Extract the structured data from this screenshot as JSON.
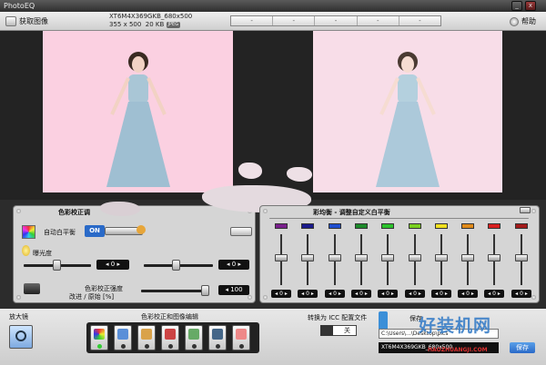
{
  "window": {
    "title": "PhotoEQ",
    "minimize": "_",
    "close": "x"
  },
  "toolbar": {
    "open_label": "获取图像",
    "help_label": "帮助"
  },
  "file": {
    "name": "XT6M4X369GKB_680x500",
    "dimensions": "355 x 500",
    "size": "20 KB",
    "format": "JPEG"
  },
  "zoom_buttons": [
    "-",
    "-",
    "-",
    "-",
    "-"
  ],
  "color_correction": {
    "title": "色彩校正调",
    "auto_wb_label": "自动白平衡",
    "auto_wb_state": "ON",
    "exposure_label": "曝光度",
    "exposure_value": "0",
    "exposure_value2": "0",
    "strength_label": "色彩校正强度",
    "strength_sublabel": "改进 / 原始 [%]",
    "strength_value": "100",
    "strength_level_percent": 100
  },
  "equalizer": {
    "title": "彩均衡 - 调整自定义白平衡",
    "channels": [
      {
        "color": "#7a1f8c",
        "value": "0"
      },
      {
        "color": "#1a1a8c",
        "value": "0"
      },
      {
        "color": "#1f4fd0",
        "value": "0"
      },
      {
        "color": "#1c8a2a",
        "value": "0"
      },
      {
        "color": "#2cc22c",
        "value": "0"
      },
      {
        "color": "#7ad01f",
        "value": "0"
      },
      {
        "color": "#f0e020",
        "value": "0"
      },
      {
        "color": "#e08a1a",
        "value": "0"
      },
      {
        "color": "#d81f1f",
        "value": "0"
      },
      {
        "color": "#a31a1a",
        "value": "0"
      }
    ]
  },
  "bottom": {
    "magnifier_label": "放大镜",
    "editing_title": "色彩校正和图像编辑",
    "icc_label": "转换为 ICC 配置文件",
    "icc_value": "关",
    "save_label": "保存",
    "path_text": "C:\\Users\\...\\Desktop\\pics",
    "output_file": "XT6M4X369GKB_680x500",
    "save_button": "保存"
  },
  "watermark": {
    "text": "好装机网",
    "sub": "HAOZHUANGJI.COM"
  }
}
